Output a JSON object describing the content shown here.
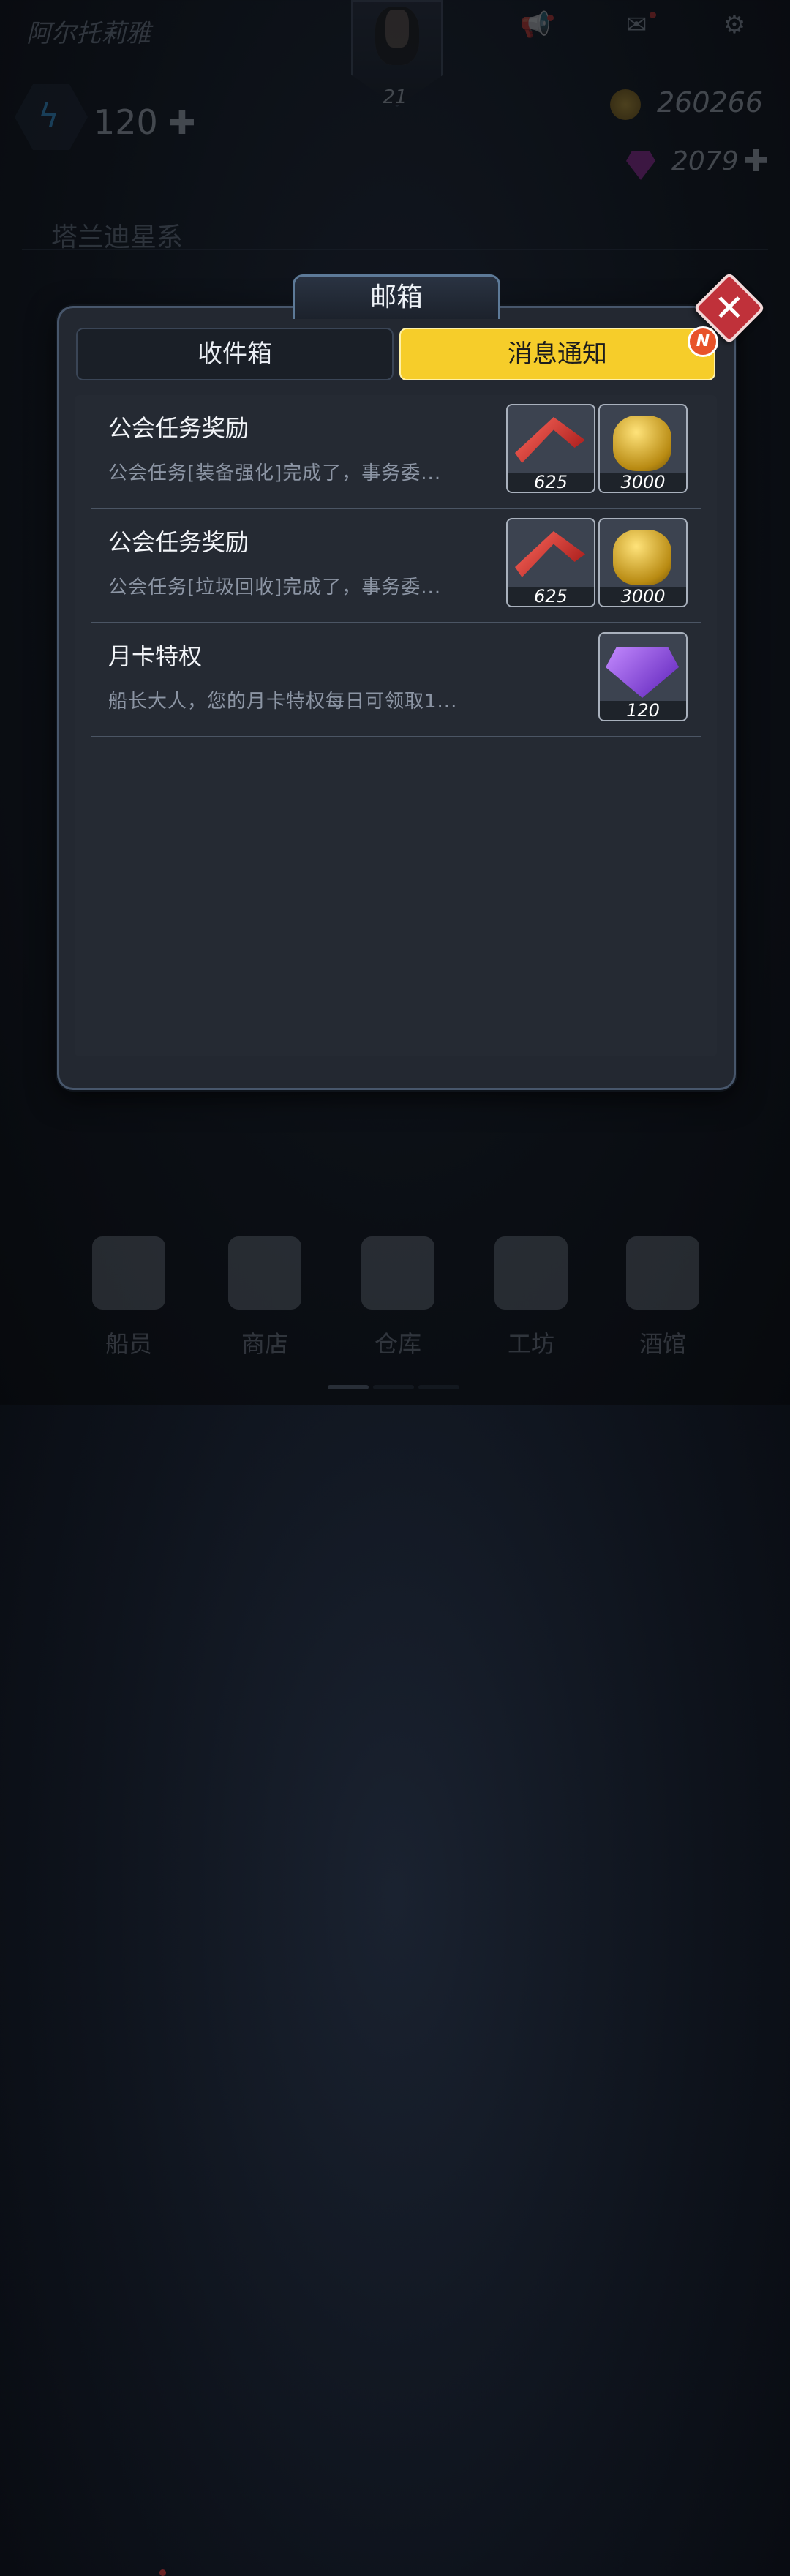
{
  "header": {
    "player_name": "阿尔托莉雅",
    "level": "21",
    "energy": "120",
    "coins": "260266",
    "gems": "2079",
    "galaxy": "塔兰迪星系"
  },
  "icons": {
    "announcement": "megaphone-icon",
    "mail": "mail-icon",
    "settings": "gear-icon"
  },
  "mailbox": {
    "title": "邮箱",
    "tabs": [
      {
        "label": "收件箱",
        "active": false
      },
      {
        "label": "消息通知",
        "active": true,
        "badge": "N"
      }
    ],
    "messages": [
      {
        "title": "公会任务奖励",
        "preview": "公会任务[装备强化]完成了，事务委...",
        "rewards": [
          {
            "icon": "red-part-icon",
            "qty": "625"
          },
          {
            "icon": "gold-coins-icon",
            "qty": "3000"
          }
        ]
      },
      {
        "title": "公会任务奖励",
        "preview": "公会任务[垃圾回收]完成了，事务委...",
        "rewards": [
          {
            "icon": "red-part-icon",
            "qty": "625"
          },
          {
            "icon": "gold-coins-icon",
            "qty": "3000"
          }
        ]
      },
      {
        "title": "月卡特权",
        "preview": "船长大人，您的月卡特权每日可领取1...",
        "rewards": [
          {
            "icon": "purple-gems-icon",
            "qty": "120"
          }
        ]
      }
    ]
  },
  "nav": [
    {
      "label": "船员",
      "icon": "crew-icon",
      "dot": true
    },
    {
      "label": "商店",
      "icon": "shop-icon",
      "dot": false
    },
    {
      "label": "仓库",
      "icon": "warehouse-icon",
      "dot": false
    },
    {
      "label": "工坊",
      "icon": "workshop-icon",
      "dot": false
    },
    {
      "label": "酒馆",
      "icon": "tavern-icon",
      "dot": false
    }
  ],
  "colors": {
    "accent_yellow": "#f6cd2a",
    "close_red": "#c0313a",
    "panel": "#232831"
  }
}
